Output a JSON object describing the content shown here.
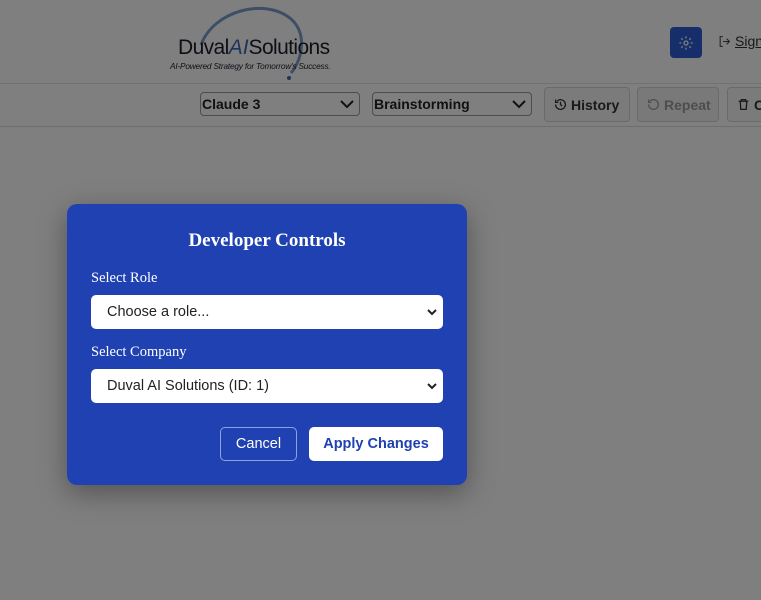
{
  "header": {
    "logo": {
      "name_prefix": "Duval",
      "name_ai": "AI",
      "name_suffix": "Solutions",
      "tagline": "AI-Powered Strategy for Tomorrow's Success."
    },
    "settings_icon": "gear-icon",
    "signout_icon": "sign-out-icon",
    "signout_label": "Sign"
  },
  "toolbar": {
    "model_select": {
      "value": "Claude 3"
    },
    "mode_select": {
      "value": "Brainstorming"
    },
    "history_label": "History",
    "repeat_label": "Repeat",
    "clear_label": "C"
  },
  "modal": {
    "title": "Developer Controls",
    "role_label": "Select Role",
    "role_value": "Choose a role...",
    "company_label": "Select Company",
    "company_value": "Duval AI Solutions (ID: 1)",
    "cancel_label": "Cancel",
    "apply_label": "Apply Changes"
  },
  "colors": {
    "modal_bg": "#1f41b1",
    "settings_bg": "#2d5fd6",
    "logo_accent": "#3f66b9"
  }
}
